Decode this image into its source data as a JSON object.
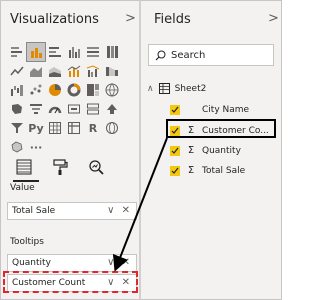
{
  "visualizations": {
    "title": "Visualizations",
    "collapse_glyph": ">",
    "gallery": [
      "stacked-bar-icon",
      "clustered-bar-icon",
      "stacked-column-icon",
      "clustered-column-icon",
      "stacked-bar-100-icon",
      "stacked-column-100-icon",
      "line-chart-icon",
      "area-chart-icon",
      "stacked-area-icon",
      "line-column-icon",
      "line-clustered-column-icon",
      "ribbon-chart-icon",
      "waterfall-icon",
      "scatter-icon",
      "pie-chart-icon",
      "donut-chart-icon",
      "treemap-icon",
      "map-icon",
      "filled-map-icon",
      "funnel-icon",
      "gauge-icon",
      "card-icon",
      "multi-row-card-icon",
      "kpi-icon",
      "slicer-icon",
      "python-visual-icon",
      "table-icon",
      "matrix-icon",
      "r-visual-icon",
      "globe-icon",
      "shape-map-icon",
      "more-visuals-icon"
    ],
    "py_text": "Py",
    "r_text": "R",
    "more_text": "···",
    "sections": {
      "value_label": "Value",
      "value_field": "Total Sale",
      "tooltips_label": "Tooltips",
      "tooltips_fields": [
        "Quantity",
        "Customer Count"
      ]
    }
  },
  "fields": {
    "title": "Fields",
    "collapse_glyph": ">",
    "search_placeholder": "Search",
    "table_name": "Sheet2",
    "items": [
      {
        "label": "City Name",
        "checked": true,
        "sigma": ""
      },
      {
        "label": "Customer Co...",
        "checked": true,
        "sigma": "Σ"
      },
      {
        "label": "Quantity",
        "checked": true,
        "sigma": "Σ"
      },
      {
        "label": "Total Sale",
        "checked": true,
        "sigma": "Σ"
      }
    ]
  },
  "colors": {
    "checkbox": "#f2c811",
    "highlight_dashed": "#e0262e",
    "highlight_solid": "#000000",
    "pane_bg": "#f3f2f1"
  }
}
